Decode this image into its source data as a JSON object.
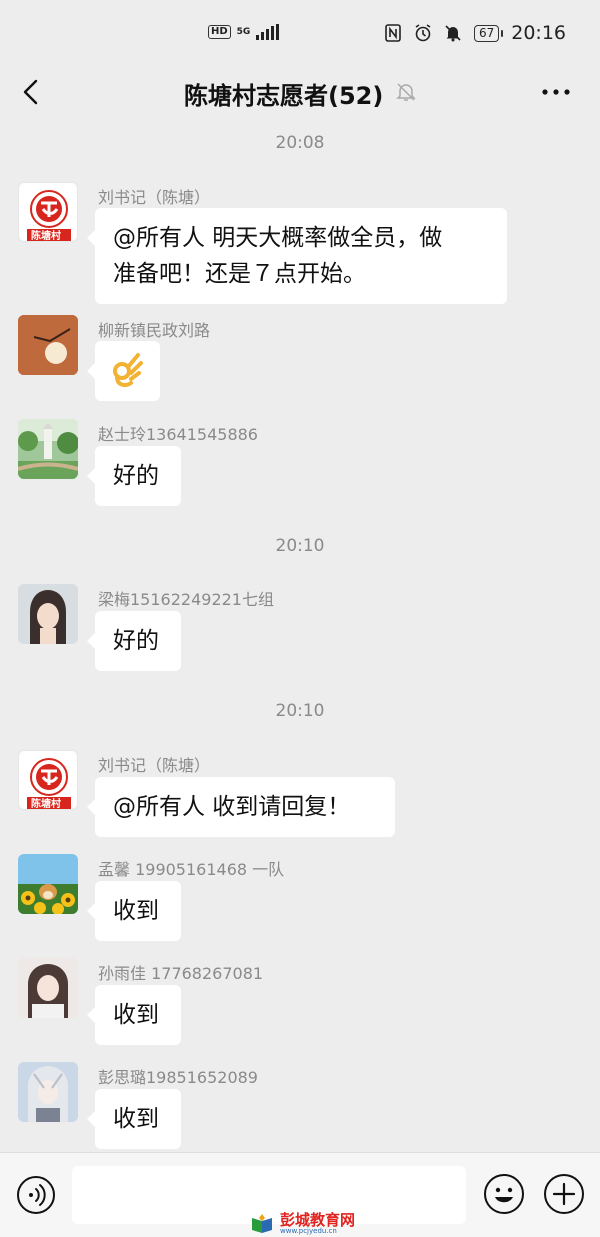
{
  "status_bar": {
    "hd": "HD",
    "network": "5G",
    "battery": "67",
    "time": "20:16"
  },
  "header": {
    "title": "陈塘村志愿者(52)",
    "back_icon": "chevron-left-icon",
    "mute_icon": "bell-off-icon",
    "more_icon": "more-horizontal-icon"
  },
  "chat": {
    "timestamps": [
      "20:08",
      "20:10",
      "20:10"
    ],
    "messages": [
      {
        "sender": "刘书记（陈塘）",
        "lines": [
          "@所有人  明天大概率做全员，做",
          "准备吧！还是７点开始。"
        ],
        "avatar": "village-logo"
      },
      {
        "sender": "柳新镇民政刘路",
        "emoji": "ok-hand-emoji",
        "avatar": "sunset-bird"
      },
      {
        "sender": "赵士玲13641545886",
        "lines": [
          "好的"
        ],
        "avatar": "garden-scene"
      },
      {
        "sender": "梁梅15162249221七组",
        "lines": [
          "好的"
        ],
        "avatar": "portrait-woman"
      },
      {
        "sender": "刘书记（陈塘）",
        "lines": [
          "@所有人  收到请回复！"
        ],
        "avatar": "village-logo"
      },
      {
        "sender": "孟馨 19905161468 一队",
        "lines": [
          "收到"
        ],
        "avatar": "sunflower-dog"
      },
      {
        "sender": "孙雨佳    17768267081",
        "lines": [
          "收到"
        ],
        "avatar": "portrait-girl"
      },
      {
        "sender": "彭思璐19851652089",
        "lines": [
          "收到"
        ],
        "avatar": "anime-girl"
      }
    ],
    "logo_text": "陈塘村"
  },
  "input_bar": {
    "value": "",
    "placeholder": ""
  },
  "watermark": {
    "title": "彭城教育网",
    "url": "www.pcjyedu.cn"
  },
  "colors": {
    "background": "#ededed",
    "bubble": "#ffffff",
    "meta_text": "#8a8a8a",
    "logo_red": "#d7261e"
  }
}
